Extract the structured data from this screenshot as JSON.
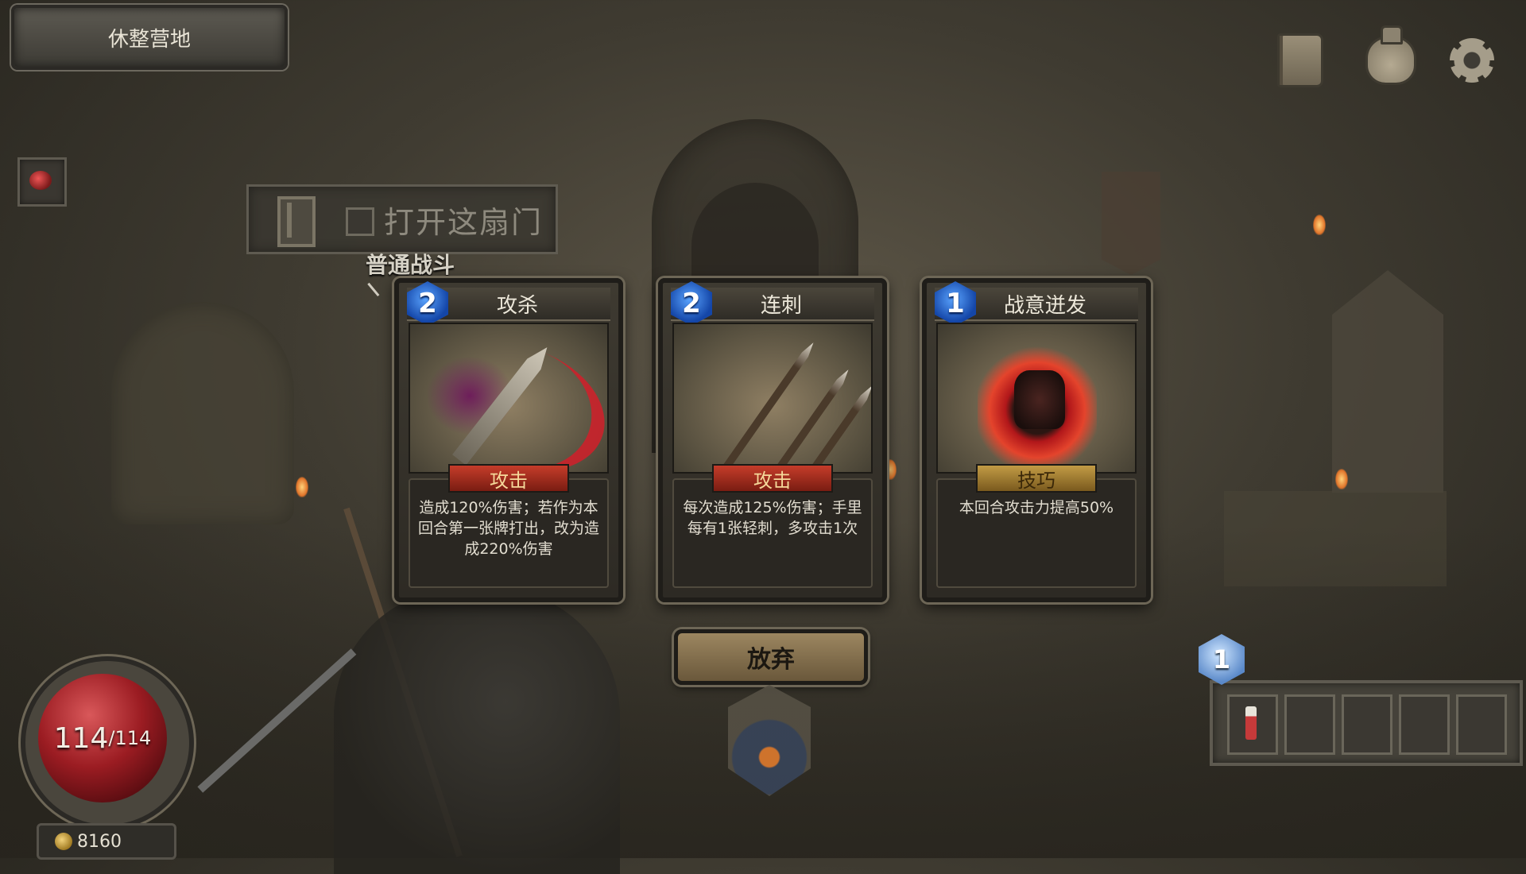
{
  "location": {
    "title": "休整营地"
  },
  "top_icons": [
    "book-icon",
    "bag-icon",
    "gear-icon"
  ],
  "door_prompt": {
    "label": "打开这扇门",
    "checked": false
  },
  "battle_type": "普通战斗",
  "cards": [
    {
      "cost": "2",
      "name": "攻杀",
      "type": "攻击",
      "description": "造成120%伤害；若作为本回合第一张牌打出，改为造成220%伤害"
    },
    {
      "cost": "2",
      "name": "连刺",
      "type": "攻击",
      "description": "每次造成125%伤害；手里每有1张轻刺，多攻击1次"
    },
    {
      "cost": "1",
      "name": "战意迸发",
      "type": "技巧",
      "description": "本回合攻击力提高50%"
    }
  ],
  "abandon_label": "放弃",
  "player": {
    "hp_current": "114",
    "hp_max": "/114",
    "gold": "8160"
  },
  "potions": {
    "count": "1",
    "slots": [
      "red-potion",
      "empty",
      "empty",
      "empty",
      "empty"
    ]
  },
  "colors": {
    "hp_red": "#9b1c22",
    "attack_banner": "#c53c2a",
    "skill_banner": "#c29b45",
    "cost_gem": "#1446a8"
  }
}
